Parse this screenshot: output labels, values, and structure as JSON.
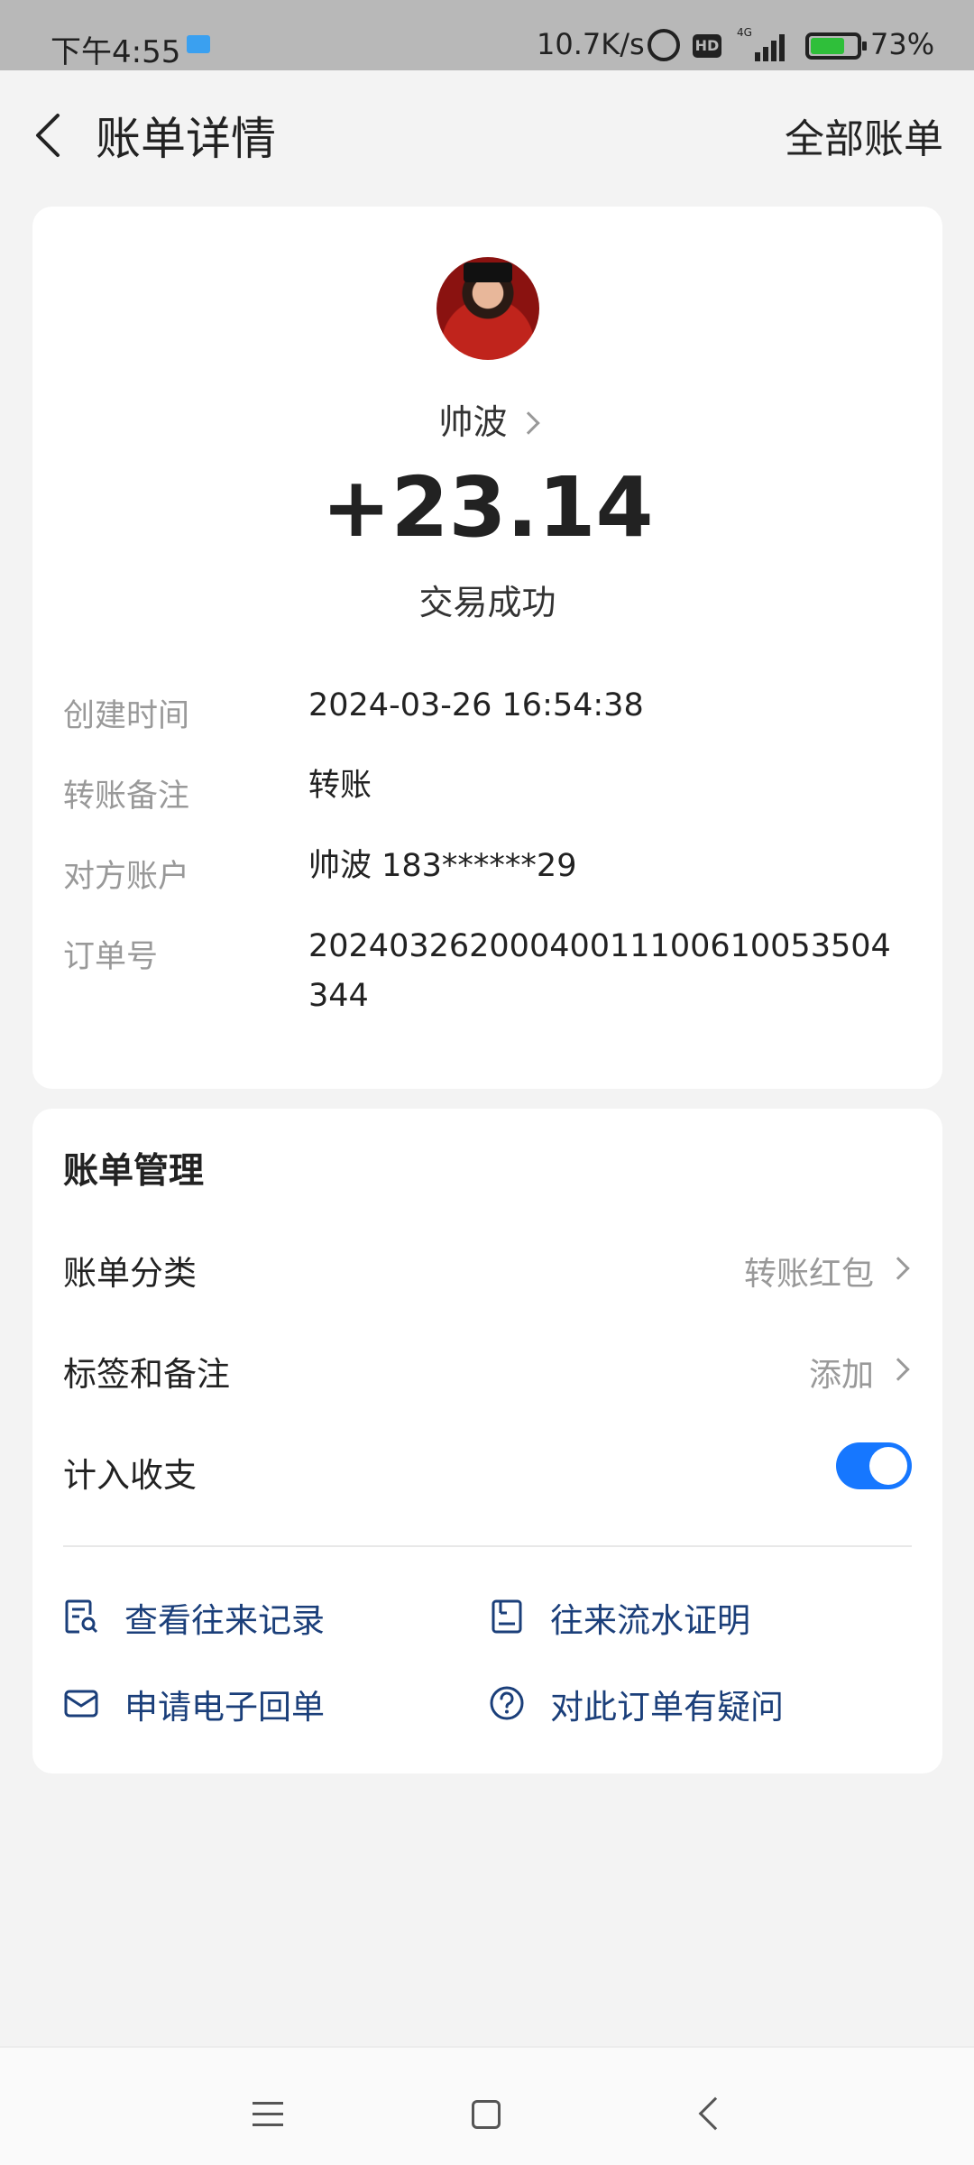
{
  "status_bar": {
    "time": "下午4:55",
    "network_speed": "10.7K/s",
    "hd_badge": "HD",
    "network_type": "4G",
    "battery_percent": "73%",
    "battery_level": 0.73
  },
  "header": {
    "title": "账单详情",
    "right_action": "全部账单"
  },
  "transaction": {
    "payee": "帅波",
    "amount": "+23.14",
    "status": "交易成功",
    "details": [
      {
        "label": "创建时间",
        "value": "2024-03-26 16:54:38"
      },
      {
        "label": "转账备注",
        "value": "转账"
      },
      {
        "label": "对方账户",
        "value": "帅波 183******29"
      },
      {
        "label": "订单号",
        "value": "20240326200040011100610053504344"
      }
    ]
  },
  "management": {
    "title": "账单管理",
    "category": {
      "label": "账单分类",
      "value": "转账红包"
    },
    "tags": {
      "label": "标签和备注",
      "value": "添加"
    },
    "include_in_stats": {
      "label": "计入收支",
      "enabled": true
    },
    "actions": [
      {
        "label": "查看往来记录",
        "icon": "record-search-icon"
      },
      {
        "label": "往来流水证明",
        "icon": "statement-icon"
      },
      {
        "label": "申请电子回单",
        "icon": "mail-icon"
      },
      {
        "label": "对此订单有疑问",
        "icon": "question-icon"
      }
    ]
  },
  "colors": {
    "accent": "#1677ff",
    "link": "#1b3f7a",
    "muted": "#999999"
  }
}
